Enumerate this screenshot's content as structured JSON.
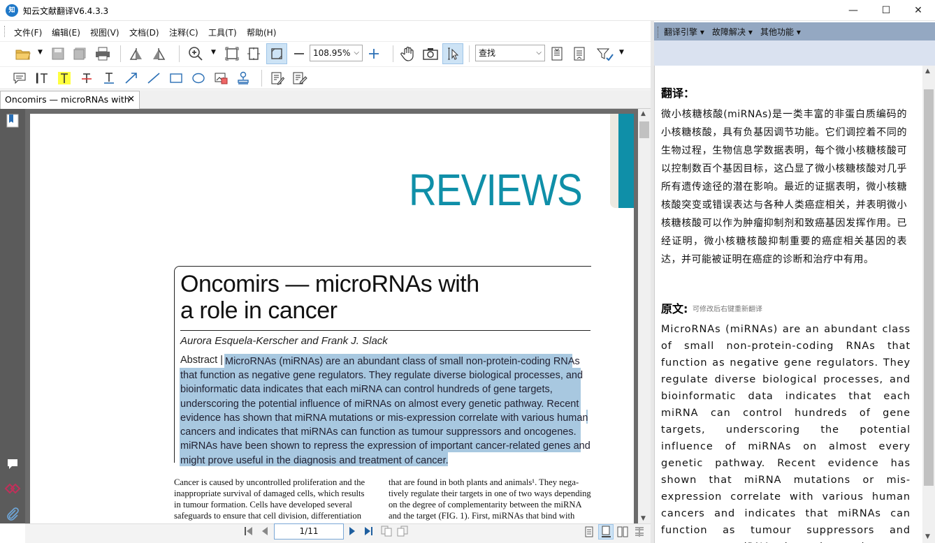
{
  "window": {
    "title": "知云文献翻译V6.4.3.3",
    "logo": "知",
    "minimize": "—",
    "maximize": "☐",
    "close": "✕"
  },
  "menu": [
    "文件(F)",
    "编辑(E)",
    "视图(V)",
    "文档(D)",
    "注释(C)",
    "工具(T)",
    "帮助(H)"
  ],
  "toolbar": {
    "zoom": "108.95%",
    "find_placeholder": "查找"
  },
  "tab": {
    "label": "Oncomirs — microRNAs with",
    "close": "✕"
  },
  "document": {
    "header": "REVIEWS",
    "title_line1": "Oncomirs — microRNAs with",
    "title_line2": "a role in cancer",
    "authors": "Aurora Esquela-Kerscher and Frank J. Slack",
    "abstract_label": "Abstract |",
    "abstract_lines": [
      "MicroRNAs (miRNAs) are an abundant class of small non-protein-coding RNAs",
      "that function as negative gene regulators. They regulate diverse biological processes, and",
      "bioinformatic data indicates that each miRNA can control hundreds of gene targets,",
      "underscoring the potential influence of miRNAs on almost every genetic pathway. Recent",
      "evidence has shown that miRNA mutations or mis-expression correlate with various human",
      "cancers and indicates that miRNAs can function as tumour suppressors and oncogenes.",
      "miRNAs have been shown to repress the expression of important cancer-related genes and",
      "might prove useful in the diagnosis and treatment of cancer."
    ],
    "col1": [
      "Cancer is caused by uncontrolled proliferation and the",
      "inappropriate survival of damaged cells, which results",
      "in tumour formation. Cells have developed several",
      "safeguards to ensure that cell division, differentiation"
    ],
    "col2": [
      "that are found in both plants and animals¹. They nega-",
      "tively regulate their targets in one of two ways depending",
      "on the degree of complementarity between the miRNA",
      "and the target (FIG. 1). First, miRNAs that bind with"
    ]
  },
  "status": {
    "page": "1/11"
  },
  "right_menu": [
    "翻译引擎 ▾",
    "故障解决 ▾",
    "其他功能 ▾"
  ],
  "translation": {
    "heading": "翻译：",
    "text": "微小核糖核酸(miRNAs)是一类丰富的非蛋白质编码的小核糖核酸，具有负基因调节功能。它们调控着不同的生物过程，生物信息学数据表明，每个微小核糖核酸可以控制数百个基因目标，这凸显了微小核糖核酸对几乎所有遗传途径的潜在影响。最近的证据表明，微小核糖核酸突变或错误表达与各种人类癌症相关，并表明微小核糖核酸可以作为肿瘤抑制剂和致癌基因发挥作用。已经证明，微小核糖核酸抑制重要的癌症相关基因的表达，并可能被证明在癌症的诊断和治疗中有用。"
  },
  "original": {
    "heading": "原文:",
    "hint": "可修改后右键重新翻译",
    "text": "MicroRNAs (miRNAs) are an abundant class of small non-protein-coding RNAs that function as negative gene regulators. They regulate diverse biological processes, and bioinformatic data indicates that each miRNA can control hundreds of gene targets, underscoring the potential influence of miRNAs on almost every genetic pathway. Recent evidence has shown that miRNA mutations or mis-expression correlate with various human cancers and indicates that miRNAs can function as tumour suppressors and oncogenes. miRNAs have been shown to repress the expression of"
  },
  "colors": {
    "accent": "#0f8fa8",
    "highlight": "#a8c8e0",
    "rightbar": "#94a8c2"
  }
}
